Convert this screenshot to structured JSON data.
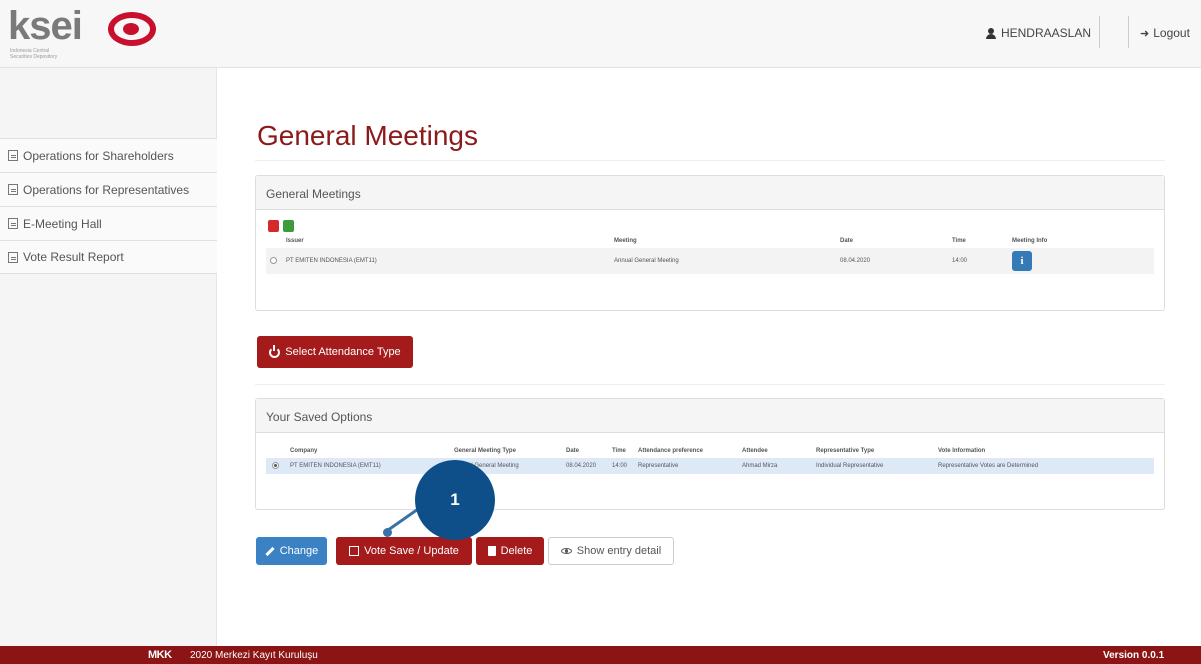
{
  "header": {
    "logo_text": "ksei",
    "logo_subtitle": "Indonesia Central Securities Depository",
    "username": "HENDRAASLAN",
    "logout_label": "Logout"
  },
  "sidebar": {
    "items": [
      {
        "label": "Operations for Shareholders"
      },
      {
        "label": "Operations for Representatives"
      },
      {
        "label": "E-Meeting Hall"
      },
      {
        "label": "Vote Result Report"
      }
    ]
  },
  "main": {
    "page_title": "General Meetings",
    "meetings_panel": {
      "title": "General Meetings",
      "columns": [
        "Issuer",
        "Meeting",
        "Date",
        "Time",
        "Meeting Info"
      ],
      "rows": [
        {
          "issuer": "PT EMITEN INDONESIA (EMT11)",
          "meeting": "Annual General Meeting",
          "date": "08.04.2020",
          "time": "14:00"
        }
      ]
    },
    "attendance_button": "Select Attendance Type",
    "saved_panel": {
      "title": "Your Saved Options",
      "columns": [
        "Company",
        "General Meeting Type",
        "Date",
        "Time",
        "Attendance preference",
        "Attendee",
        "Representative Type",
        "Vote Information"
      ],
      "rows": [
        {
          "company": "PT EMITEN INDONESIA (EMT11)",
          "meeting_type": "Annual General Meeting",
          "date": "08.04.2020",
          "time": "14:00",
          "attendance": "Representative",
          "attendee": "Ahmad Mirza",
          "rep_type": "Individual Representative",
          "vote_info": "Representative Votes are Determined"
        }
      ]
    },
    "buttons": {
      "change": "Change",
      "vote_save": "Vote Save / Update",
      "delete": "Delete",
      "show_detail": "Show entry detail"
    },
    "callout_number": "1"
  },
  "footer": {
    "logo": "MKK",
    "copyright": "2020 Merkezi Kayıt Kuruluşu",
    "version": "Version 0.0.1"
  },
  "colors": {
    "brand_red": "#a51a1a",
    "title_red": "#8b1a1a",
    "primary_blue": "#3b82c4",
    "callout_blue": "#0e4f8a",
    "footer_bg": "#8b1414"
  }
}
